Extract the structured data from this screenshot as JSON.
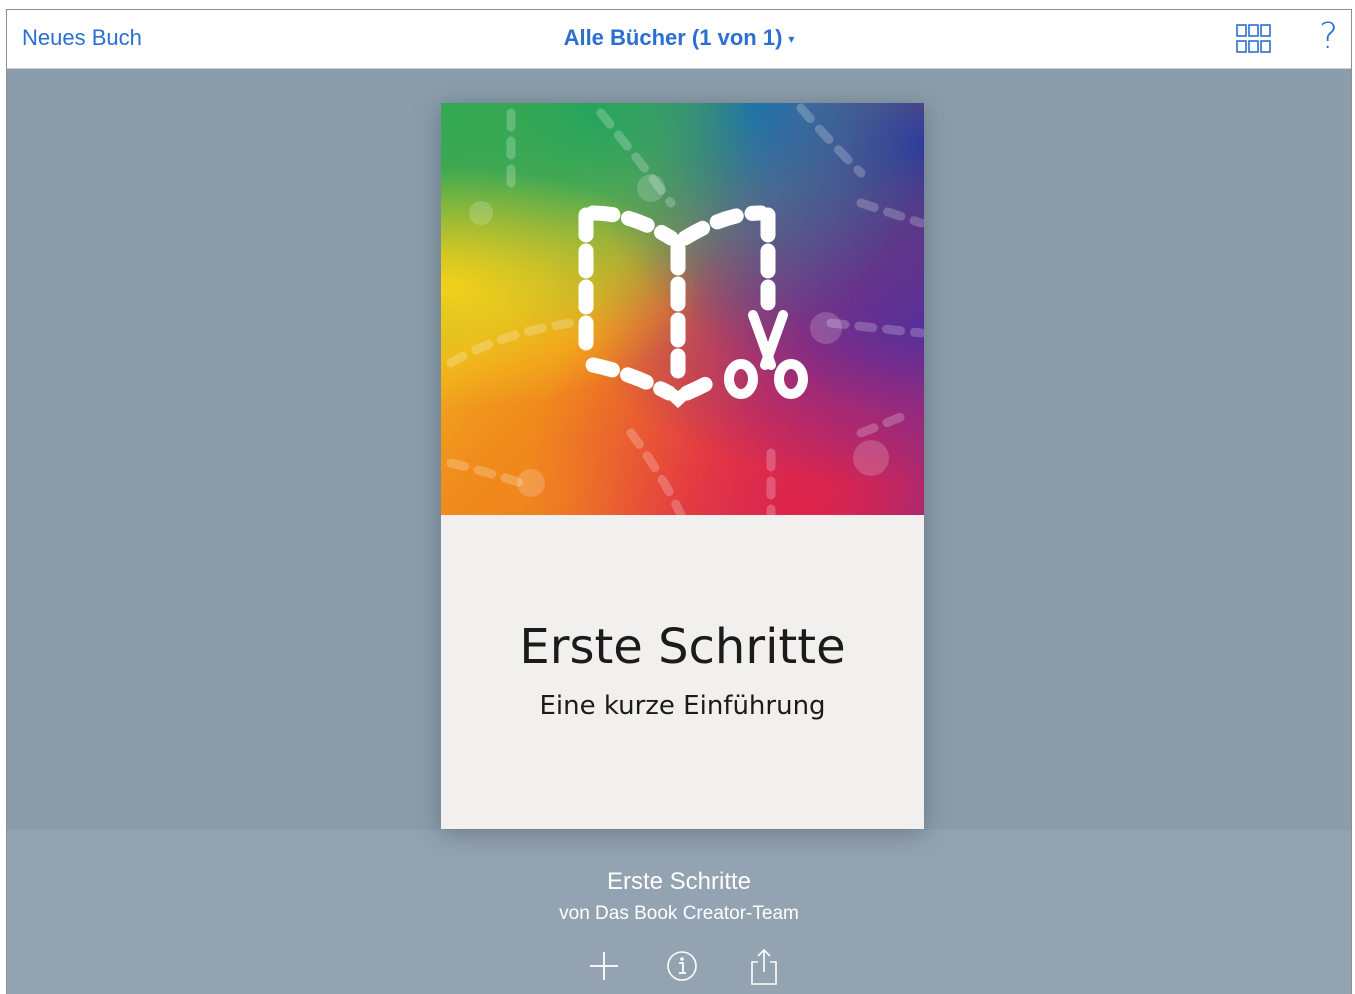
{
  "topbar": {
    "new_book_label": "Neues Buch",
    "title": "Alle Bücher (1 von 1)",
    "caret": "▾",
    "help_label": "?"
  },
  "book": {
    "cover_title": "Erste Schritte",
    "cover_subtitle": "Eine kurze Einführung"
  },
  "info": {
    "title": "Erste Schritte",
    "author": "von Das Book Creator-Team"
  },
  "icons": {
    "grid": "grid-view-icon",
    "help": "help-icon",
    "add": "add-icon",
    "info": "info-icon",
    "share": "share-icon"
  },
  "colors": {
    "accent": "#2a6fd1",
    "background": "#8a9caa"
  }
}
